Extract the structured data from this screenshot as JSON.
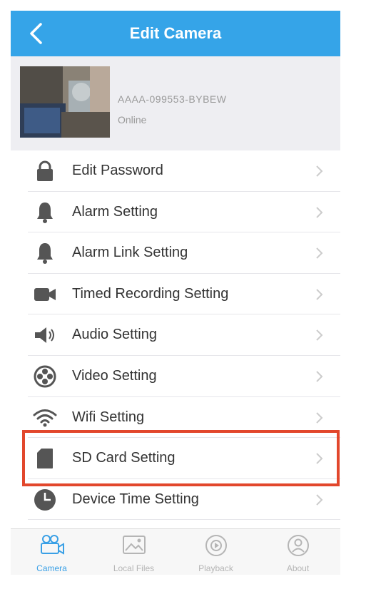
{
  "header": {
    "title": "Edit Camera"
  },
  "camera": {
    "id": "AAAA-099553-BYBEW",
    "status": "Online"
  },
  "menu": [
    {
      "label": "Edit Password",
      "icon": "lock-icon"
    },
    {
      "label": "Alarm Setting",
      "icon": "bell-icon"
    },
    {
      "label": "Alarm Link Setting",
      "icon": "bell-icon"
    },
    {
      "label": "Timed Recording Setting",
      "icon": "video-camera-icon"
    },
    {
      "label": "Audio Setting",
      "icon": "speaker-icon"
    },
    {
      "label": "Video Setting",
      "icon": "film-reel-icon"
    },
    {
      "label": "Wifi Setting",
      "icon": "wifi-icon"
    },
    {
      "label": "SD Card Setting",
      "icon": "sd-card-icon"
    },
    {
      "label": "Device Time Setting",
      "icon": "clock-icon"
    }
  ],
  "tabs": [
    {
      "label": "Camera",
      "icon": "camera-icon",
      "active": true
    },
    {
      "label": "Local Files",
      "icon": "image-icon",
      "active": false
    },
    {
      "label": "Playback",
      "icon": "playback-icon",
      "active": false
    },
    {
      "label": "About",
      "icon": "person-icon",
      "active": false
    }
  ],
  "colors": {
    "nav_bar": "#35a4e8",
    "highlight_border": "#e2472c",
    "active_tab": "#3aa0e6",
    "icon": "#555555"
  }
}
